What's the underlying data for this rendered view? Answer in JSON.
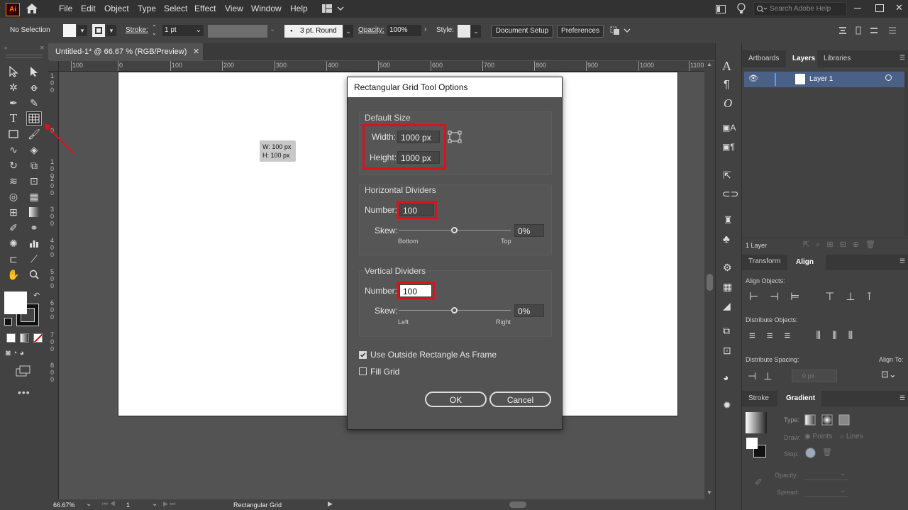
{
  "menubar": {
    "app_logo": "Ai",
    "items": [
      "File",
      "Edit",
      "Object",
      "Type",
      "Select",
      "Effect",
      "View",
      "Window",
      "Help"
    ],
    "search_placeholder": "Search Adobe Help"
  },
  "controlbar": {
    "selection": "No Selection",
    "stroke_label": "Stroke:",
    "stroke_weight": "1 pt",
    "brush": "3 pt. Round",
    "opacity_label": "Opacity:",
    "opacity_value": "100%",
    "style_label": "Style:",
    "document_setup": "Document Setup",
    "preferences": "Preferences"
  },
  "document": {
    "tab_title": "Untitled-1* @ 66.67 % (RGB/Preview)",
    "close_glyph": "✕"
  },
  "ruler": {
    "h_labels": [
      "100",
      "0",
      "100",
      "200",
      "300",
      "400",
      "500",
      "600",
      "700",
      "800",
      "900",
      "1000",
      "1100"
    ],
    "v_labels": [
      [
        "1",
        "0",
        "0"
      ],
      [
        "0"
      ],
      [
        "1",
        "0",
        "0"
      ],
      [
        "2",
        "0",
        "0"
      ],
      [
        "3",
        "0",
        "0"
      ],
      [
        "4",
        "0",
        "0"
      ],
      [
        "5",
        "0",
        "0"
      ],
      [
        "6",
        "0",
        "0"
      ],
      [
        "7",
        "0",
        "0"
      ],
      [
        "8",
        "0",
        "0"
      ]
    ]
  },
  "tooltip": {
    "w": "W: 100 px",
    "h": "H: 100 px"
  },
  "status": {
    "zoom": "66.67%",
    "artboard_num": "1",
    "tool_name": "Rectangular Grid"
  },
  "panels": {
    "top_tabs": [
      "Artboards",
      "Layers",
      "Libraries"
    ],
    "layer_name": "Layer 1",
    "layer_count": "1 Layer",
    "mid_tabs": [
      "Transform",
      "Align"
    ],
    "align_objects": "Align Objects:",
    "distribute_objects": "Distribute Objects:",
    "distribute_spacing": "Distribute Spacing:",
    "align_to": "Align To:",
    "spacing_value": "0 px",
    "bottom_tabs": [
      "Stroke",
      "Gradient"
    ],
    "type_label": "Type:",
    "draw_label": "Draw:",
    "points_label": "Points",
    "lines_label": "Lines",
    "stop_label": "Stop:",
    "opacity_label": "Opacity:",
    "spread_label": "Spread:"
  },
  "dialog": {
    "title": "Rectangular Grid Tool Options",
    "default_size": {
      "title": "Default Size",
      "width_label": "Width:",
      "width_value": "1000 px",
      "height_label": "Height:",
      "height_value": "1000 px"
    },
    "horizontal": {
      "title": "Horizontal Dividers",
      "number_label": "Number:",
      "number_value": "100",
      "skew_label": "Skew:",
      "skew_value": "0%",
      "left_end": "Bottom",
      "right_end": "Top",
      "skew_fraction": 0.5
    },
    "vertical": {
      "title": "Vertical Dividers",
      "number_label": "Number:",
      "number_value": "100",
      "skew_label": "Skew:",
      "skew_value": "0%",
      "left_end": "Left",
      "right_end": "Right",
      "skew_fraction": 0.5
    },
    "use_outside": {
      "label": "Use Outside Rectangle As Frame",
      "checked": true
    },
    "fill_grid": {
      "label": "Fill Grid",
      "checked": false
    },
    "ok": "OK",
    "cancel": "Cancel"
  },
  "colors": {
    "highlight": "#d8141b",
    "arrow": "#d8141b",
    "logo_bg": "#ff7c00"
  }
}
